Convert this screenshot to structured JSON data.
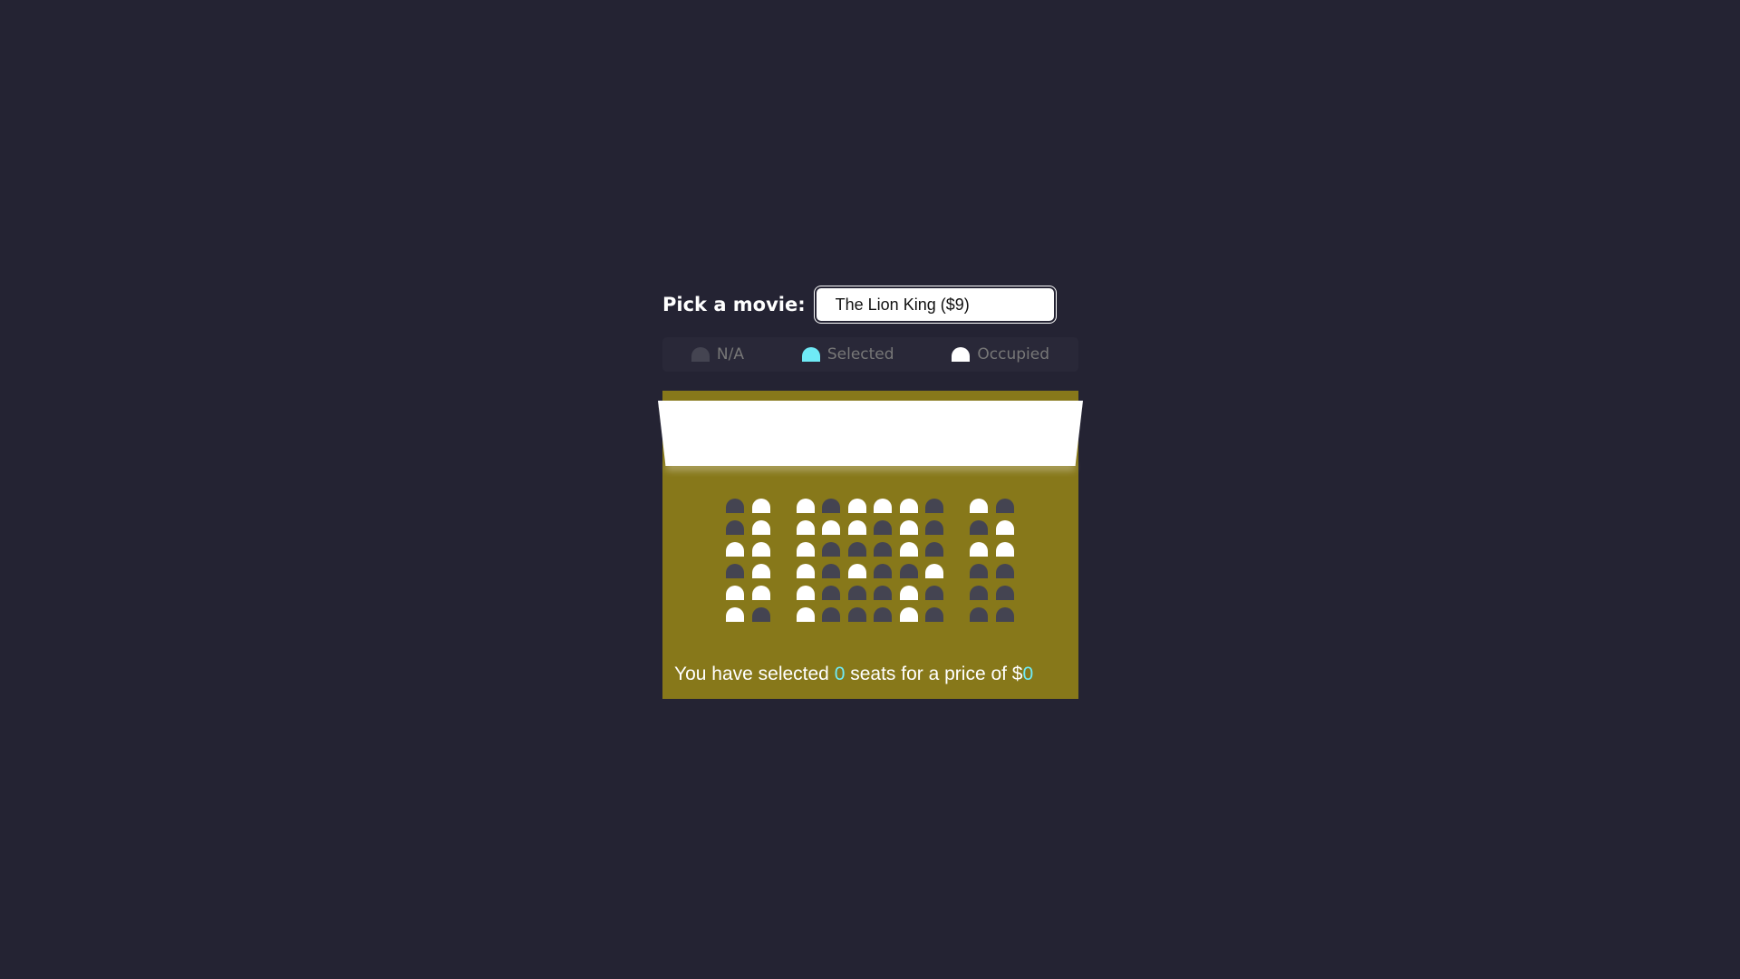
{
  "picker": {
    "label": "Pick a movie:",
    "selected": "The Lion King ($9)"
  },
  "legend": [
    {
      "label": "N/A",
      "state": "na"
    },
    {
      "label": "Selected",
      "state": "selected"
    },
    {
      "label": "Occupied",
      "state": "occupied"
    }
  ],
  "seats": {
    "rows": [
      [
        "na",
        "occupied",
        "occupied",
        "na",
        "occupied",
        "occupied",
        "occupied",
        "na",
        "occupied",
        "na"
      ],
      [
        "na",
        "occupied",
        "occupied",
        "occupied",
        "occupied",
        "na",
        "occupied",
        "na",
        "na",
        "occupied"
      ],
      [
        "occupied",
        "occupied",
        "occupied",
        "na",
        "na",
        "na",
        "occupied",
        "na",
        "occupied",
        "occupied"
      ],
      [
        "na",
        "occupied",
        "occupied",
        "na",
        "occupied",
        "na",
        "na",
        "occupied",
        "na",
        "na"
      ],
      [
        "occupied",
        "occupied",
        "occupied",
        "na",
        "na",
        "na",
        "occupied",
        "na",
        "na",
        "na"
      ],
      [
        "occupied",
        "na",
        "occupied",
        "na",
        "na",
        "na",
        "occupied",
        "na",
        "na",
        "na"
      ]
    ]
  },
  "summary": {
    "prefix": "You have selected ",
    "count": "0",
    "middle": " seats for a price of $",
    "total": "0"
  },
  "colors": {
    "background": "#242333",
    "theater": "#87781a",
    "na": "#444451",
    "selected": "#6feaf6",
    "occupied": "#ffffff"
  }
}
